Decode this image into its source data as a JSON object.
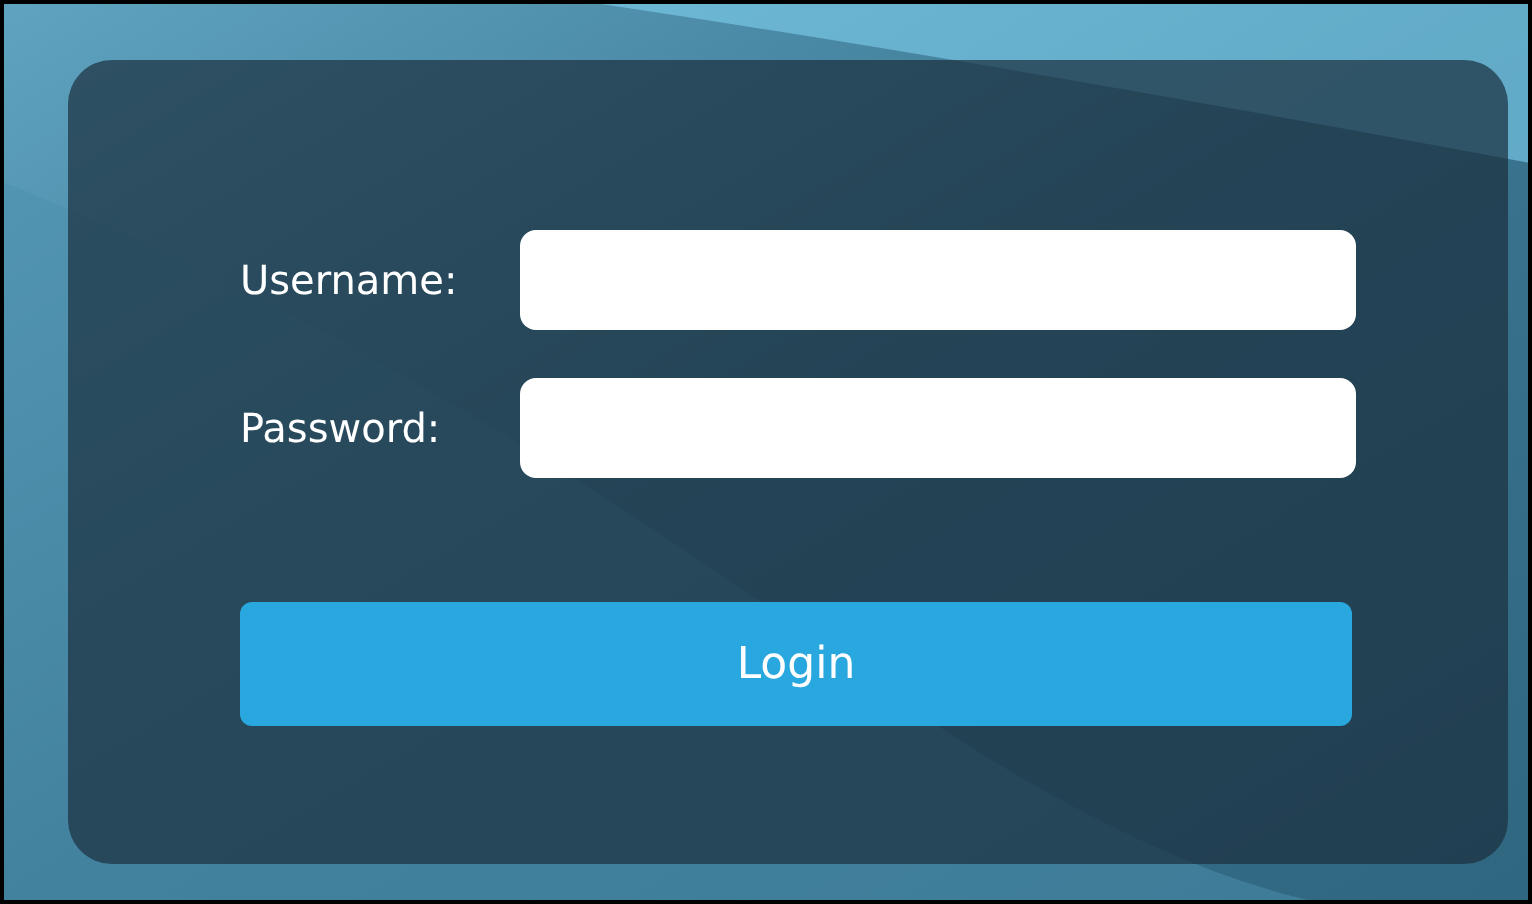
{
  "form": {
    "fields": [
      {
        "label": "Username:"
      },
      {
        "label": "Password:"
      }
    ],
    "submit": {
      "label": "Login"
    }
  }
}
